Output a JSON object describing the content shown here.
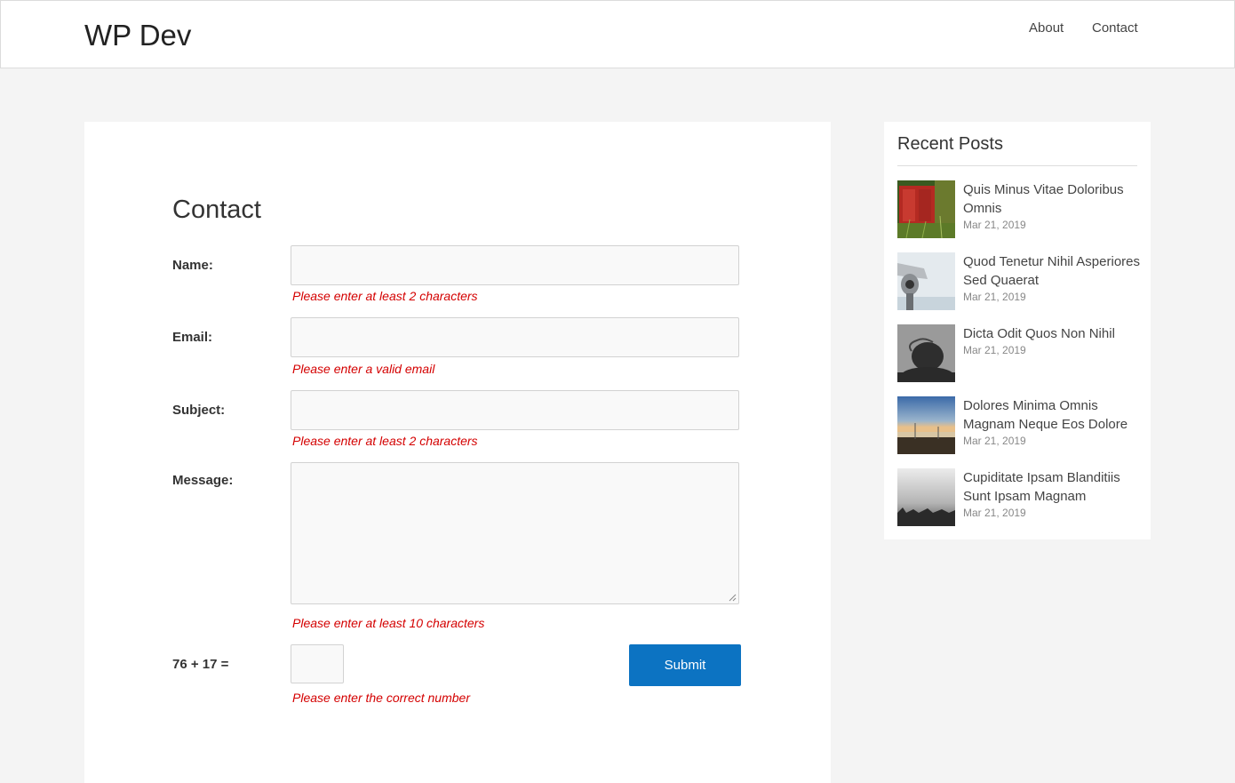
{
  "site": {
    "title": "WP Dev"
  },
  "nav": {
    "items": [
      "About",
      "Contact"
    ]
  },
  "form": {
    "heading": "Contact",
    "fields": [
      {
        "label": "Name:",
        "value": "",
        "error": "Please enter at least 2 characters"
      },
      {
        "label": "Email:",
        "value": "",
        "error": "Please enter a valid email"
      },
      {
        "label": "Subject:",
        "value": "",
        "error": "Please enter at least 2 characters"
      },
      {
        "label": "Message:",
        "value": "",
        "error": "Please enter at least 10 characters"
      }
    ],
    "captcha": {
      "question": "76 + 17 =",
      "value": "",
      "error": "Please enter the correct number"
    },
    "submit_label": "Submit"
  },
  "sidebar": {
    "title": "Recent Posts",
    "posts": [
      {
        "title": "Quis Minus Vitae Doloribus Omnis",
        "date": "Mar 21, 2019",
        "thumb": "red-door-thumbnail"
      },
      {
        "title": "Quod Tenetur Nihil Asperiores Sed Quaerat",
        "date": "Mar 21, 2019",
        "thumb": "binocular-viewer-thumbnail"
      },
      {
        "title": "Dicta Odit Quos Non Nihil",
        "date": "Mar 21, 2019",
        "thumb": "gray-portrait-thumbnail"
      },
      {
        "title": "Dolores Minima Omnis Magnam Neque Eos Dolore",
        "date": "Mar 21, 2019",
        "thumb": "coast-landscape-thumbnail"
      },
      {
        "title": "Cupiditate Ipsam Blanditiis Sunt Ipsam Magnam",
        "date": "Mar 21, 2019",
        "thumb": "foggy-field-thumbnail"
      }
    ]
  },
  "colors": {
    "accent": "#0c73c2",
    "error": "#d40000",
    "background": "#f4f4f4"
  }
}
